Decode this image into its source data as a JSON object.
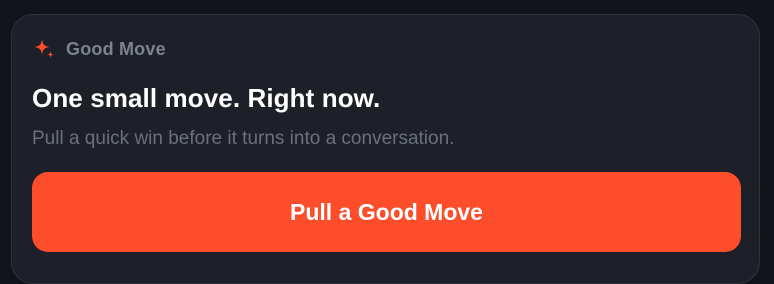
{
  "card": {
    "icon": "sparkle-icon",
    "header_label": "Good Move",
    "title": "One small move. Right now.",
    "subtitle": "Pull a quick win before it turns into a conversation.",
    "cta_label": "Pull a Good Move"
  },
  "colors": {
    "page_background": "#121419",
    "card_background": "#1d2029",
    "accent": "#fd4d2b",
    "header_text": "#7c8290",
    "subtitle_text": "#6a707d",
    "title_text": "#ffffff"
  }
}
